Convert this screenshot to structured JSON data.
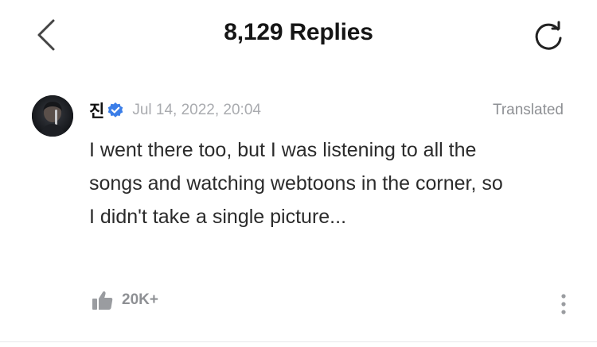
{
  "header": {
    "title": "8,129 Replies",
    "back_icon": "chevron-left-icon",
    "refresh_icon": "refresh-icon"
  },
  "comment": {
    "author": "진",
    "verified_icon": "verified-badge-icon",
    "timestamp": "Jul 14, 2022, 20:04",
    "translated_label": "Translated",
    "text": "I went there too, but I was listening to all the songs and watching webtoons in the corner, so I didn't take a single picture...",
    "like_icon": "thumbs-up-icon",
    "like_count": "20K+",
    "more_icon": "more-vertical-icon"
  },
  "colors": {
    "verified_blue": "#3b7ee8",
    "muted_text": "#a9abaf",
    "icon_gray": "#8e9094"
  }
}
